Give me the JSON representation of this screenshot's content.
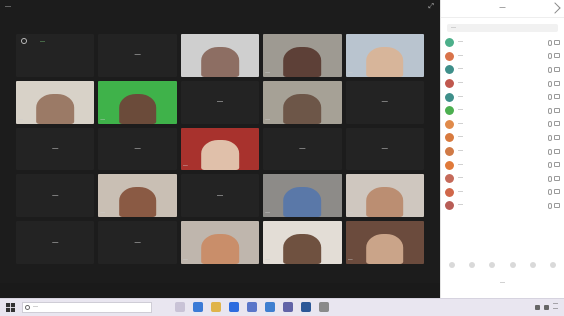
{
  "window": {
    "title": "—",
    "view_toggle": "⤢"
  },
  "tiles": [
    {
      "name": "",
      "corner": "",
      "self_label": "—",
      "kind": "dark"
    },
    {
      "name": "—",
      "corner": "",
      "kind": "dark"
    },
    {
      "name": "",
      "corner": "—",
      "kind": "video",
      "bg": "#cfcfcf",
      "skin": "#8d6e63"
    },
    {
      "name": "",
      "corner": "—",
      "kind": "video",
      "bg": "#9e9a92",
      "skin": "#5d4037"
    },
    {
      "name": "",
      "corner": "—",
      "kind": "video",
      "bg": "#b9c4cf",
      "skin": "#d7b59a"
    },
    {
      "name": "",
      "corner": "—",
      "kind": "video",
      "bg": "#d8d2c8",
      "skin": "#9b7a66"
    },
    {
      "name": "",
      "corner": "—",
      "kind": "video",
      "bg": "#3fb24a",
      "skin": "#6b4b3a"
    },
    {
      "name": "—",
      "corner": "",
      "kind": "dark"
    },
    {
      "name": "",
      "corner": "—",
      "kind": "video",
      "bg": "#a6a196",
      "skin": "#6d5648"
    },
    {
      "name": "—",
      "corner": "",
      "kind": "dark"
    },
    {
      "name": "—",
      "corner": "",
      "kind": "dark"
    },
    {
      "name": "—",
      "corner": "",
      "kind": "dark"
    },
    {
      "name": "",
      "corner": "—",
      "kind": "video",
      "bg": "#a8322d",
      "skin": "#e0c0aa"
    },
    {
      "name": "—",
      "corner": "",
      "kind": "dark"
    },
    {
      "name": "—",
      "corner": "",
      "kind": "dark"
    },
    {
      "name": "—",
      "corner": "",
      "kind": "dark"
    },
    {
      "name": "",
      "corner": "—",
      "kind": "video",
      "bg": "#c9bfb4",
      "skin": "#8a5a44"
    },
    {
      "name": "—",
      "corner": "",
      "kind": "dark"
    },
    {
      "name": "",
      "corner": "—",
      "kind": "video",
      "bg": "#8d8b88",
      "skin": "#5a78a8",
      "active": true
    },
    {
      "name": "",
      "corner": "—",
      "kind": "video",
      "bg": "#cfc7bf",
      "skin": "#bb8e72"
    },
    {
      "name": "—",
      "corner": "",
      "kind": "dark"
    },
    {
      "name": "—",
      "corner": "",
      "kind": "dark"
    },
    {
      "name": "",
      "corner": "—",
      "kind": "video",
      "bg": "#bfb6ad",
      "skin": "#c98e6a"
    },
    {
      "name": "",
      "corner": "—",
      "kind": "video",
      "bg": "#e3ddd6",
      "skin": "#6f5140"
    },
    {
      "name": "",
      "corner": "—",
      "kind": "video",
      "bg": "#6b4b3d",
      "skin": "#caa489"
    }
  ],
  "panel": {
    "title": "—",
    "search_placeholder": "—",
    "participants": [
      {
        "name": "—",
        "color": "#4caf8a"
      },
      {
        "name": "—",
        "color": "#d9734a"
      },
      {
        "name": "—",
        "color": "#3e8f8a"
      },
      {
        "name": "—",
        "color": "#c0584e"
      },
      {
        "name": "—",
        "color": "#3e8f8a"
      },
      {
        "name": "—",
        "color": "#4caf50"
      },
      {
        "name": "—",
        "color": "#e08a4a"
      },
      {
        "name": "—",
        "color": "#d87a3e"
      },
      {
        "name": "—",
        "color": "#d07a46"
      },
      {
        "name": "—",
        "color": "#e07a3a"
      },
      {
        "name": "—",
        "color": "#c56a5a"
      },
      {
        "name": "—",
        "color": "#d0674a"
      },
      {
        "name": "—",
        "color": "#b85d56"
      }
    ],
    "footer": "—"
  },
  "taskbar": {
    "search_placeholder": "—",
    "apps": [
      {
        "icon": "task-view-icon",
        "color": "#c9c3d6"
      },
      {
        "icon": "edge-icon",
        "color": "#3b7bd6"
      },
      {
        "icon": "file-explorer-icon",
        "color": "#e0b44a"
      },
      {
        "icon": "zoom-icon",
        "color": "#2d6cdf"
      },
      {
        "icon": "store-icon",
        "color": "#5a76c9"
      },
      {
        "icon": "mail-icon",
        "color": "#3f7fd0"
      },
      {
        "icon": "teams-icon",
        "color": "#6264a7"
      },
      {
        "icon": "word-icon",
        "color": "#2b5797"
      },
      {
        "icon": "settings-icon",
        "color": "#8a8a8a"
      }
    ],
    "clock_time": "—",
    "clock_date": "—"
  },
  "colors": {
    "accent": "#6ad36a",
    "video_bg": "#1c1c1c",
    "tile_bg": "#232323"
  }
}
